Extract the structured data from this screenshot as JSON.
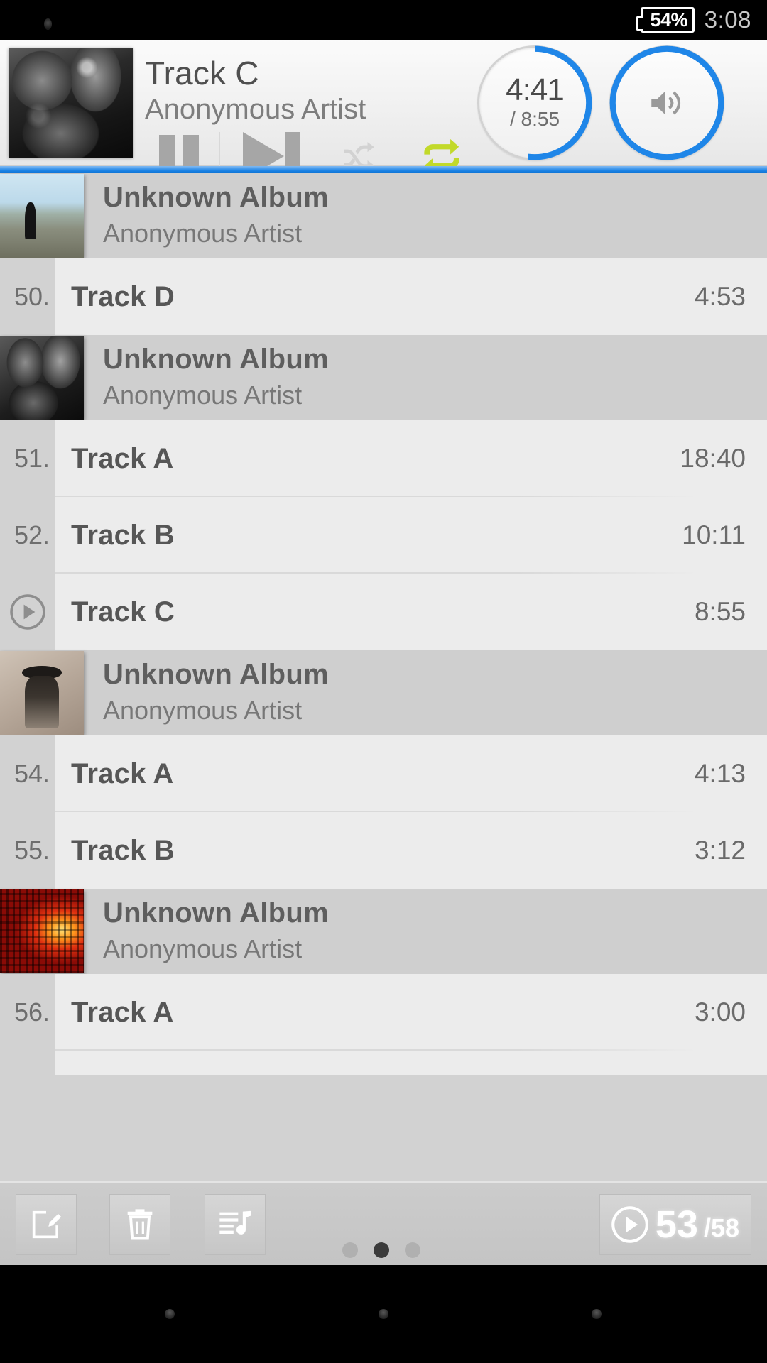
{
  "status_bar": {
    "notification_icon": "dot-icon",
    "battery_text": "54%",
    "clock": "3:08"
  },
  "player": {
    "album_art": "jazz-band-photo",
    "title": "Track C",
    "artist": "Anonymous Artist",
    "controls": {
      "pause": "pause-icon",
      "next": "next-track-icon",
      "shuffle": "shuffle-icon",
      "repeat": "repeat-icon"
    },
    "shuffle_enabled": false,
    "repeat_enabled": true,
    "repeat_color": "#c2d92a",
    "elapsed": "4:41",
    "duration": "/ 8:55",
    "progress_percent": 52,
    "volume_icon": "volume-up-icon",
    "volume_percent": 100,
    "accent_color": "#1f86e8"
  },
  "list": {
    "sections": [
      {
        "album": "Unknown Album",
        "artist": "Anonymous Artist",
        "art": "beach-silhouette",
        "tracks": [
          {
            "num": "50.",
            "title": "Track D",
            "duration": "4:53",
            "playing": false
          }
        ]
      },
      {
        "album": "Unknown Album",
        "artist": "Anonymous Artist",
        "art": "sax-player",
        "tracks": [
          {
            "num": "51.",
            "title": "Track A",
            "duration": "18:40",
            "playing": false
          },
          {
            "num": "52.",
            "title": "Track B",
            "duration": "10:11",
            "playing": false
          },
          {
            "num": "",
            "title": "Track C",
            "duration": "8:55",
            "playing": true
          }
        ]
      },
      {
        "album": "Unknown Album",
        "artist": "Anonymous Artist",
        "art": "hat-portrait",
        "tracks": [
          {
            "num": "54.",
            "title": "Track A",
            "duration": "4:13",
            "playing": false
          },
          {
            "num": "55.",
            "title": "Track B",
            "duration": "3:12",
            "playing": false
          }
        ]
      },
      {
        "album": "Unknown Album",
        "artist": "Anonymous Artist",
        "art": "red-abstract",
        "tracks": [
          {
            "num": "56.",
            "title": "Track A",
            "duration": "3:00",
            "playing": false
          }
        ]
      }
    ]
  },
  "toolbar": {
    "edit_icon": "edit-icon",
    "delete_icon": "trash-icon",
    "playlist_icon": "playlist-add-icon",
    "page_dots": 3,
    "active_dot": 1,
    "now_playing_icon": "play-circle-icon",
    "position": "53",
    "total": "/58"
  },
  "nav_bar": {
    "back": "back-dot",
    "home": "home-dot",
    "recents": "recents-dot"
  }
}
